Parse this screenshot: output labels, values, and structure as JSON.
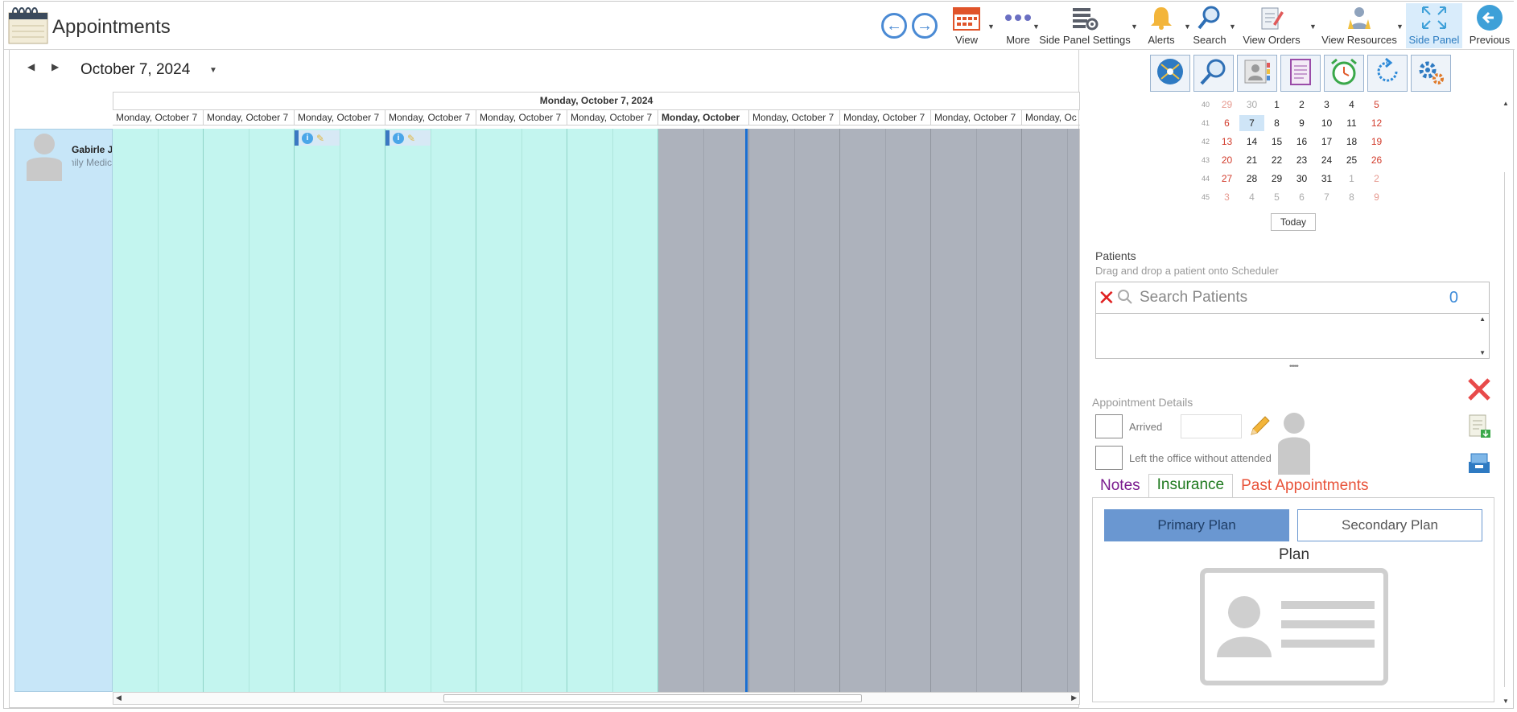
{
  "app": {
    "title": "Appointments"
  },
  "toolbar": {
    "buttons": [
      {
        "key": "view",
        "label": "View",
        "icon": "calendar-icon"
      },
      {
        "key": "more",
        "label": "More",
        "icon": "more-dots-icon"
      },
      {
        "key": "side_panel_settings",
        "label": "Side Panel Settings",
        "icon": "side-panel-settings-icon"
      },
      {
        "key": "alerts",
        "label": "Alerts",
        "icon": "bell-icon"
      },
      {
        "key": "search",
        "label": "Search",
        "icon": "search-icon"
      },
      {
        "key": "view_orders",
        "label": "View Orders",
        "icon": "orders-icon"
      },
      {
        "key": "view_resources",
        "label": "View Resources",
        "icon": "resources-icon"
      },
      {
        "key": "side_panel",
        "label": "Side Panel",
        "icon": "expand-icon"
      },
      {
        "key": "previous",
        "label": "Previous",
        "icon": "back-arrow-icon"
      }
    ]
  },
  "scheduler": {
    "date_label": "October 7, 2024",
    "day_header": "Monday, October 7, 2024",
    "columns": [
      "Monday, October 7",
      "Monday, October 7",
      "Monday, October 7",
      "Monday, October 7",
      "Monday, October 7",
      "Monday, October 7",
      "Monday, October",
      "Monday, October 7",
      "Monday, October 7",
      "Monday, October 7",
      "Monday, Oc"
    ],
    "current_column_index": 6,
    "open_columns": 6,
    "resource": {
      "name": "Gabirle J",
      "subtitle": "Family Medic"
    },
    "colors": {
      "open": "#c3f5ef",
      "closed": "#adb2bc",
      "resource": "#c7e6f8",
      "now_line": "#1a6fd1"
    }
  },
  "side_panel": {
    "calendar": {
      "weeks": [
        {
          "wk": "40",
          "days": [
            "29",
            "30",
            "1",
            "2",
            "3",
            "4",
            "5"
          ]
        },
        {
          "wk": "41",
          "days": [
            "6",
            "7",
            "8",
            "9",
            "10",
            "11",
            "12"
          ]
        },
        {
          "wk": "42",
          "days": [
            "13",
            "14",
            "15",
            "16",
            "17",
            "18",
            "19"
          ]
        },
        {
          "wk": "43",
          "days": [
            "20",
            "21",
            "22",
            "23",
            "24",
            "25",
            "26"
          ]
        },
        {
          "wk": "44",
          "days": [
            "27",
            "28",
            "29",
            "30",
            "31",
            "1",
            "2"
          ]
        },
        {
          "wk": "45",
          "days": [
            "3",
            "4",
            "5",
            "6",
            "7",
            "8",
            "9"
          ]
        }
      ],
      "selected_day": "7",
      "today_label": "Today"
    },
    "patients": {
      "title": "Patients",
      "subtitle": "Drag and drop a patient onto Scheduler",
      "search_placeholder": "Search Patients",
      "count": "0"
    },
    "appointment_details": {
      "title": "Appointment Details",
      "arrived_label": "Arrived",
      "left_label": "Left the office without attended"
    },
    "tabs": {
      "notes": "Notes",
      "insurance": "Insurance",
      "past": "Past Appointments"
    },
    "insurance": {
      "primary": "Primary Plan",
      "secondary": "Secondary Plan",
      "plan_title": "Plan"
    }
  }
}
